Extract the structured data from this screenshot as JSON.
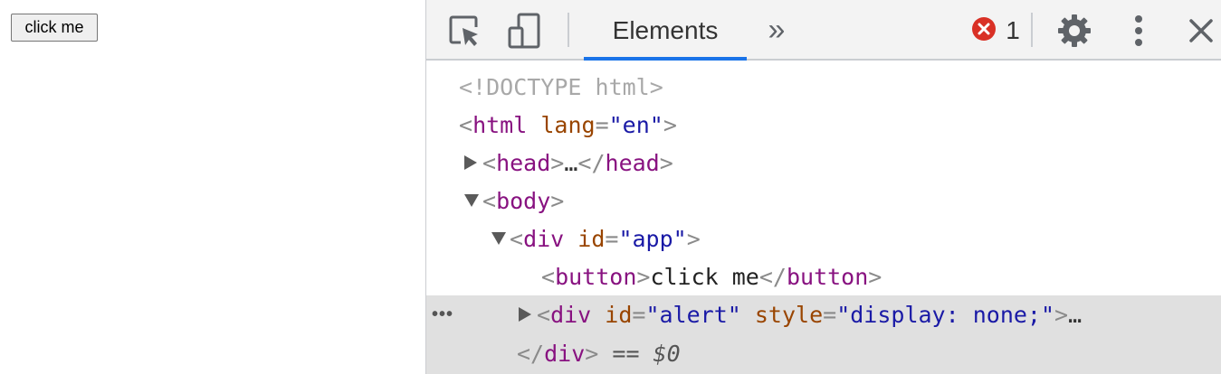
{
  "page": {
    "button_label": "click me"
  },
  "devtools": {
    "toolbar": {
      "inspect_icon": "inspect-element-icon",
      "device_icon": "device-toolbar-icon",
      "tab_elements": "Elements",
      "more_tabs": "»",
      "error_count": "1",
      "settings_icon": "gear-icon",
      "menu_icon": "kebab-menu-icon",
      "close_icon": "close-icon"
    },
    "tree": {
      "doctype": "<!DOCTYPE html>",
      "html_tag": "html",
      "html_attr_name": "lang",
      "html_attr_value": "\"en\"",
      "head_tag": "head",
      "head_close": "head",
      "ellipsis": "…",
      "body_tag": "body",
      "div_tag": "div",
      "div_attr_name": "id",
      "div_attr_value": "\"app\"",
      "button_tag": "button",
      "button_text": "click me",
      "alert_tag": "div",
      "alert_attr_name": "id",
      "alert_attr_value": "\"alert\"",
      "alert_style_name": "style",
      "alert_style_value": "\"display: none;\"",
      "close_div": "div",
      "selected_marker": "== $0",
      "dots": "•••"
    }
  },
  "colors": {
    "accent": "#1a73e8",
    "error": "#d93025",
    "selected_row": "#e0e0e0"
  }
}
